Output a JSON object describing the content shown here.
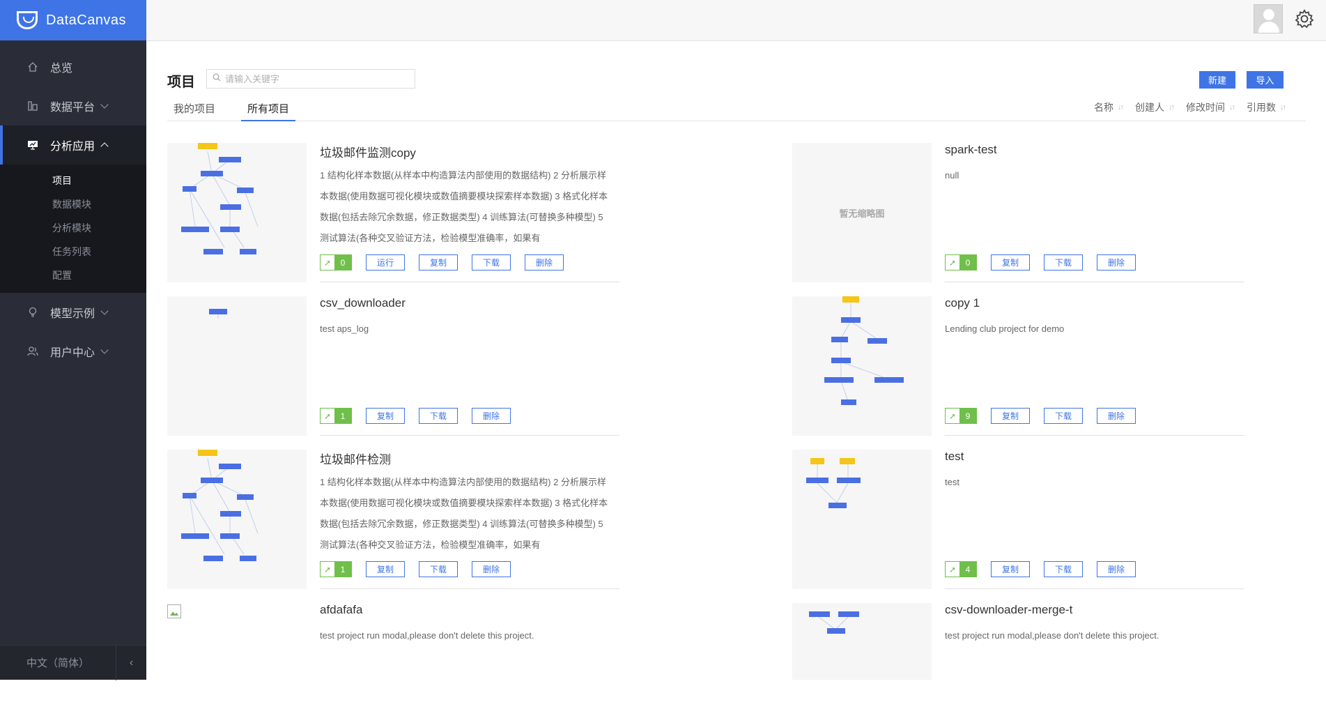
{
  "app": {
    "name": "DataCanvas"
  },
  "nav": {
    "items": [
      {
        "label": "总览",
        "icon": "home-icon"
      },
      {
        "label": "数据平台",
        "icon": "data-platform-icon"
      },
      {
        "label": "分析应用",
        "icon": "analysis-app-icon"
      },
      {
        "label": "模型示例",
        "icon": "lightbulb-icon"
      },
      {
        "label": "用户中心",
        "icon": "user-icon"
      }
    ],
    "sub_items": [
      {
        "label": "项目"
      },
      {
        "label": "数据模块"
      },
      {
        "label": "分析模块"
      },
      {
        "label": "任务列表"
      },
      {
        "label": "配置"
      }
    ],
    "language": "中文（简体）",
    "collapse_glyph": "‹"
  },
  "page": {
    "title": "项目",
    "search_placeholder": "请输入关键字",
    "new_label": "新建",
    "import_label": "导入",
    "tabs": [
      {
        "label": "我的项目"
      },
      {
        "label": "所有项目"
      }
    ],
    "sort": [
      {
        "label": "名称"
      },
      {
        "label": "创建人"
      },
      {
        "label": "修改时间"
      },
      {
        "label": "引用数"
      }
    ]
  },
  "projects": [
    {
      "name": "垃圾邮件监测copy",
      "desc": "1 结构化样本数据(从样本中构造算法内部使用的数据结构) 2 分析展示样本数据(使用数据可视化模块或数值摘要模块探索样本数据) 3 格式化样本数据(包括去除冗余数据，修正数据类型) 4 训练算法(可替换多种模型) 5 测试算法(各种交叉验证方法，检验模型准确率，如果有",
      "refs": "0",
      "run_label": "运行",
      "copy_label": "复制",
      "download_label": "下载",
      "delete_label": "删除"
    },
    {
      "name": "spark-test",
      "desc": "null",
      "refs": "0",
      "no_thumb": "暂无缩略图",
      "copy_label": "复制",
      "download_label": "下载",
      "delete_label": "删除"
    },
    {
      "name": "csv_downloader",
      "desc": "test aps_log",
      "refs": "1",
      "copy_label": "复制",
      "download_label": "下载",
      "delete_label": "删除"
    },
    {
      "name": "copy 1",
      "desc": "Lending club project for demo",
      "refs": "9",
      "copy_label": "复制",
      "download_label": "下载",
      "delete_label": "删除"
    },
    {
      "name": "垃圾邮件检测",
      "desc": "1 结构化样本数据(从样本中构造算法内部使用的数据结构) 2 分析展示样本数据(使用数据可视化模块或数值摘要模块探索样本数据) 3 格式化样本数据(包括去除冗余数据，修正数据类型) 4 训练算法(可替换多种模型) 5 测试算法(各种交叉验证方法，检验模型准确率，如果有",
      "refs": "1",
      "copy_label": "复制",
      "download_label": "下载",
      "delete_label": "删除"
    },
    {
      "name": "test",
      "desc": "test",
      "refs": "4",
      "copy_label": "复制",
      "download_label": "下载",
      "delete_label": "删除"
    },
    {
      "name": "afdafafa",
      "desc": "test project run modal,please don't delete this project."
    },
    {
      "name": "csv-downloader-merge-t",
      "desc": "test project run modal,please don't delete this project."
    }
  ],
  "colors": {
    "accent": "#3e74e6",
    "sidebar": "#2a2d37",
    "ref_green": "#6fbf4a",
    "node_blue": "#4a6fe3",
    "node_yellow": "#f5c518"
  }
}
